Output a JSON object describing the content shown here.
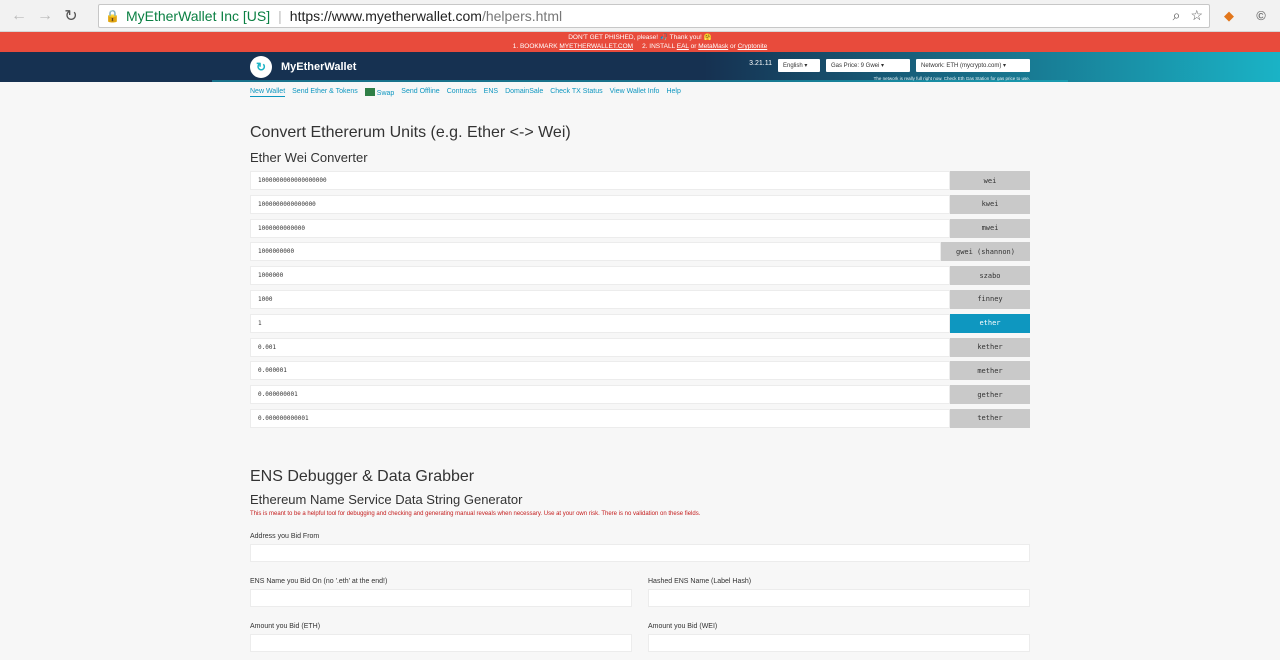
{
  "browser": {
    "secure_label": "MyEtherWallet Inc [US]",
    "url_host": "https://www.myetherwallet.com",
    "url_path": "/helpers.html"
  },
  "warning": {
    "line1": "DON'T GET PHISHED, please! 🎣 Thank you! 🤗",
    "line2_a": "1. BOOKMARK",
    "line2_link1": "MYETHERWALLET.COM",
    "line2_b": "2. INSTALL",
    "line2_link2": "EAL",
    "line2_or1": "or",
    "line2_link3": "MetaMask",
    "line2_or2": "or",
    "line2_link4": "Cryptonite"
  },
  "header": {
    "brand": "MyEtherWallet",
    "version": "3.21.11",
    "language": "English",
    "gas_price": "Gas Price: 9 Gwei",
    "network": "Network: ETH (mycrypto.com)",
    "note": "The network is really full right now. Check Eth Gas Station for gas price to use."
  },
  "nav": {
    "items": [
      "New Wallet",
      "Send Ether & Tokens",
      "Swap",
      "Send Offline",
      "Contracts",
      "ENS",
      "DomainSale",
      "Check TX Status",
      "View Wallet Info",
      "Help"
    ]
  },
  "converter": {
    "title": "Convert Ethererum Units (e.g. Ether <-> Wei)",
    "subtitle": "Ether Wei Converter",
    "rows": [
      {
        "value": "1000000000000000000",
        "unit": "wei"
      },
      {
        "value": "1000000000000000",
        "unit": "kwei"
      },
      {
        "value": "1000000000000",
        "unit": "mwei"
      },
      {
        "value": "1000000000",
        "unit": "gwei (shannon)"
      },
      {
        "value": "1000000",
        "unit": "szabo"
      },
      {
        "value": "1000",
        "unit": "finney"
      },
      {
        "value": "1",
        "unit": "ether"
      },
      {
        "value": "0.001",
        "unit": "kether"
      },
      {
        "value": "0.000001",
        "unit": "mether"
      },
      {
        "value": "0.000000001",
        "unit": "gether"
      },
      {
        "value": "0.000000000001",
        "unit": "tether"
      }
    ]
  },
  "ens": {
    "title": "ENS Debugger & Data Grabber",
    "subtitle": "Ethereum Name Service Data String Generator",
    "warning": "This is meant to be a helpful tool for debugging and checking and generating manual reveals when necessary. Use at your own risk. There is no validation on these fields.",
    "address_label": "Address you Bid From",
    "name_label": "ENS Name you Bid On (no '.eth' at the end!)",
    "hashed_label": "Hashed ENS Name (Label Hash)",
    "amount_eth_label": "Amount you Bid (ETH)",
    "amount_wei_label": "Amount you Bid (WEI)"
  }
}
